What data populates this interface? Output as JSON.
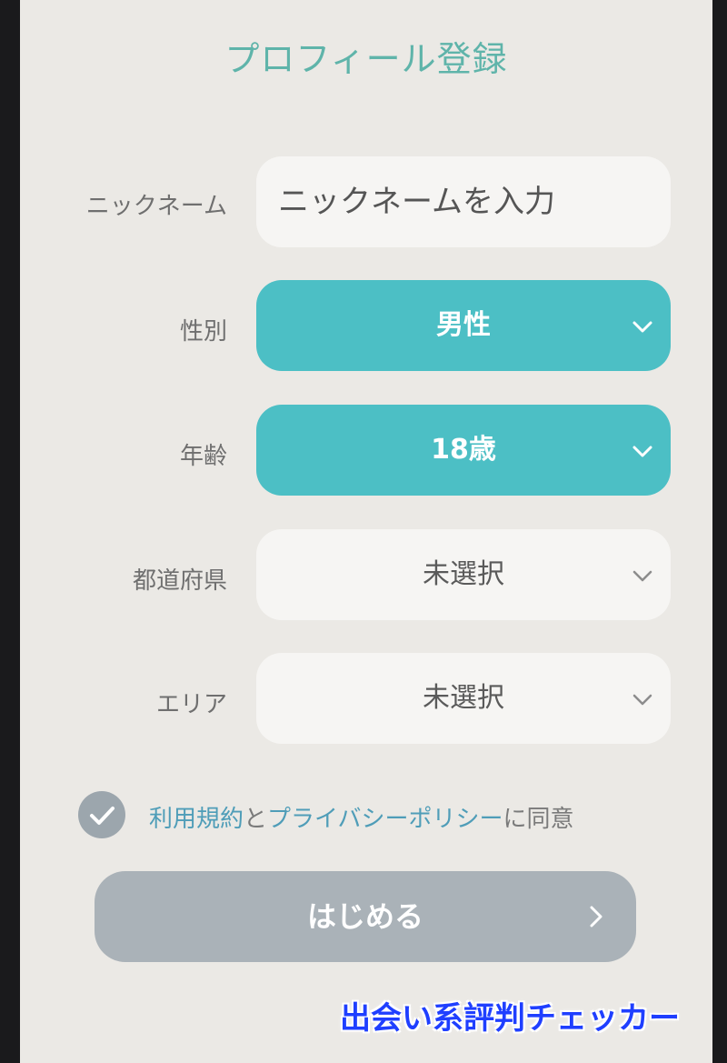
{
  "header": {
    "title": "プロフィール登録"
  },
  "form": {
    "nickname": {
      "label": "ニックネーム",
      "placeholder": "ニックネームを入力",
      "value": ""
    },
    "gender": {
      "label": "性別",
      "value": "男性"
    },
    "age": {
      "label": "年齢",
      "value": "18歳"
    },
    "prefecture": {
      "label": "都道府県",
      "value": "未選択"
    },
    "area": {
      "label": "エリア",
      "value": "未選択"
    }
  },
  "agreement": {
    "checked": true,
    "terms_link": "利用規約",
    "connector": "と",
    "privacy_link": "プライバシーポリシー",
    "suffix": "に同意"
  },
  "start_button": {
    "label": "はじめる"
  },
  "watermark": {
    "text": "出会い系評判チェッカー"
  },
  "icons": {
    "select_chevron": "chevron-down-icon",
    "start_arrow": "chevron-right-icon",
    "checkbox": "check-icon"
  },
  "colors": {
    "background": "#ebe9e5",
    "title": "#5fb4aa",
    "selected_field": "#4cbfc5",
    "empty_field": "#f6f5f3",
    "button_disabled": "#aab2b8",
    "link": "#4f9db8",
    "watermark": "#1f3fff"
  }
}
